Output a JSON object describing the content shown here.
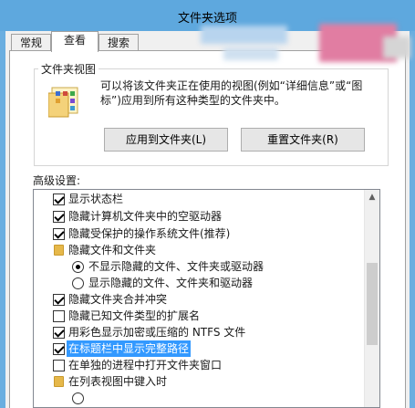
{
  "window": {
    "title": "文件夹选项"
  },
  "tabs": [
    {
      "label": "常规",
      "active": false
    },
    {
      "label": "查看",
      "active": true
    },
    {
      "label": "搜索",
      "active": false
    }
  ],
  "folder_views": {
    "group_label": "文件夹视图",
    "description_line1": "可以将该文件夹正在使用的视图(例如“详细信息”或“图",
    "description_line2": "标”)应用到所有这种类型的文件夹中。",
    "apply_button": "应用到文件夹(L)",
    "reset_button": "重置文件夹(R)",
    "icon": "folder-view-icon"
  },
  "advanced": {
    "label": "高级设置:",
    "items": [
      {
        "type": "checkbox",
        "checked": true,
        "label": "显示状态栏"
      },
      {
        "type": "checkbox",
        "checked": true,
        "label": "隐藏计算机文件夹中的空驱动器"
      },
      {
        "type": "checkbox",
        "checked": true,
        "label": "隐藏受保护的操作系统文件(推荐)"
      },
      {
        "type": "folder",
        "label": "隐藏文件和文件夹"
      },
      {
        "type": "radio",
        "checked": true,
        "label": "不显示隐藏的文件、文件夹或驱动器"
      },
      {
        "type": "radio",
        "checked": false,
        "label": "显示隐藏的文件、文件夹和驱动器"
      },
      {
        "type": "checkbox",
        "checked": true,
        "label": "隐藏文件夹合并冲突"
      },
      {
        "type": "checkbox",
        "checked": false,
        "label": "隐藏已知文件类型的扩展名"
      },
      {
        "type": "checkbox",
        "checked": true,
        "label": "用彩色显示加密或压缩的 NTFS 文件"
      },
      {
        "type": "checkbox",
        "checked": true,
        "label": "在标题栏中显示完整路径",
        "selected": true
      },
      {
        "type": "checkbox",
        "checked": false,
        "label": "在单独的进程中打开文件夹窗口"
      },
      {
        "type": "folder",
        "label": "在列表视图中键入时"
      }
    ]
  },
  "colors": {
    "titlebar": "#5ea8de",
    "selection": "#3399ff",
    "dialog_bg": "#f0f0f0"
  }
}
